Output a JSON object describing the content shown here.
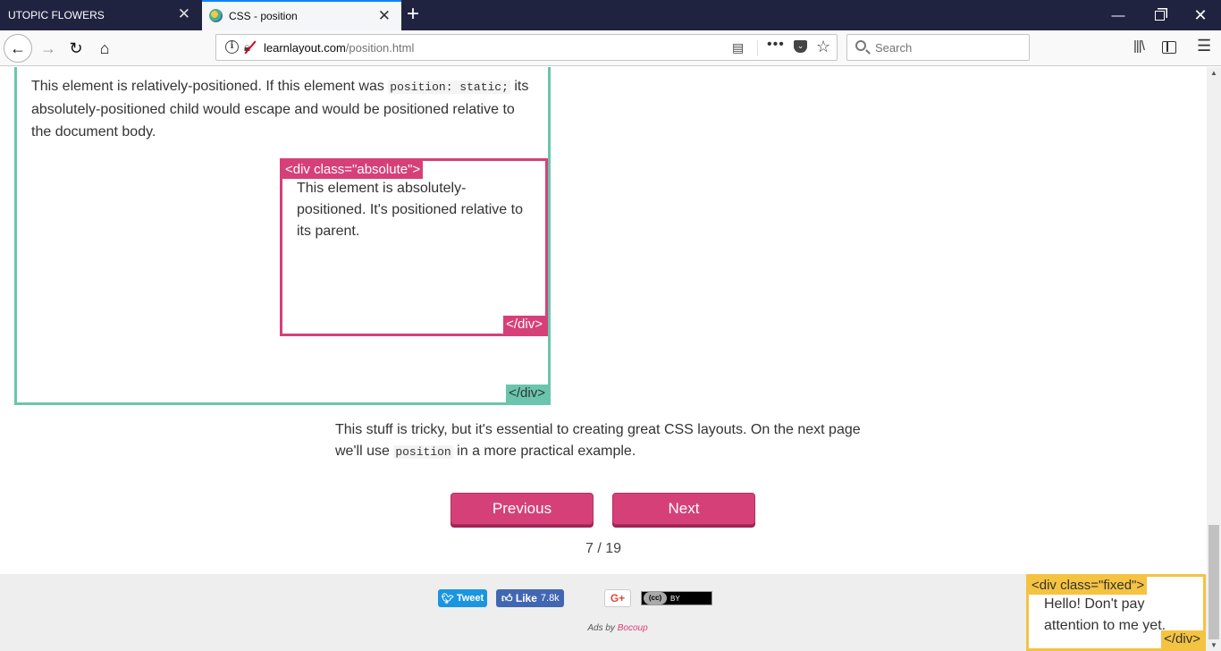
{
  "browser": {
    "tabs": [
      {
        "title": "UTOPIC FLOWERS",
        "active": false
      },
      {
        "title": "CSS - position",
        "active": true
      }
    ],
    "url_domain": "learnlayout.com",
    "url_path": "/position.html",
    "search_placeholder": "Search",
    "icons": [
      "back-icon",
      "forward-icon",
      "reload-icon",
      "home-icon",
      "site-info-icon",
      "insecure-lock-icon",
      "reader-view-icon",
      "page-actions-icon",
      "pocket-icon",
      "bookmark-star-icon",
      "search-icon",
      "library-icon",
      "sidebar-icon",
      "menu-icon"
    ]
  },
  "page": {
    "relative": {
      "text_before": "This element is relatively-positioned. If this element was ",
      "code": "position: static;",
      "text_after": " its absolutely-positioned child would escape and would be positioned relative to the document body.",
      "close_tag": "</div>"
    },
    "absolute": {
      "open_tag": "<div class=\"absolute\">",
      "text": "This element is absolutely-positioned. It's positioned relative to its parent.",
      "close_tag": "</div>"
    },
    "body": {
      "text_before": "This stuff is tricky, but it's essential to creating great CSS layouts. On the next page we'll use ",
      "code": "position",
      "text_after": " in a more practical example."
    },
    "pager": {
      "previous_label": "Previous",
      "next_label": "Next",
      "page_count": "7 / 19"
    },
    "footer": {
      "tweet_label": "Tweet",
      "like_label": "Like",
      "like_count": "7.8k",
      "gplus_label": "G+",
      "cc_label": "(cc)",
      "cc_by": "BY",
      "ads_prefix": "Ads by ",
      "ads_brand": "Bocoup"
    },
    "fixed": {
      "open_tag": "<div class=\"fixed\">",
      "text": "Hello! Don't pay attention to me yet.",
      "close_tag": "</div>"
    }
  },
  "colors": {
    "relative_border": "#6ac5ac",
    "absolute_border": "#d64078",
    "fixed_border": "#f5c342",
    "button": "#d64078",
    "tabbar": "#202340"
  }
}
